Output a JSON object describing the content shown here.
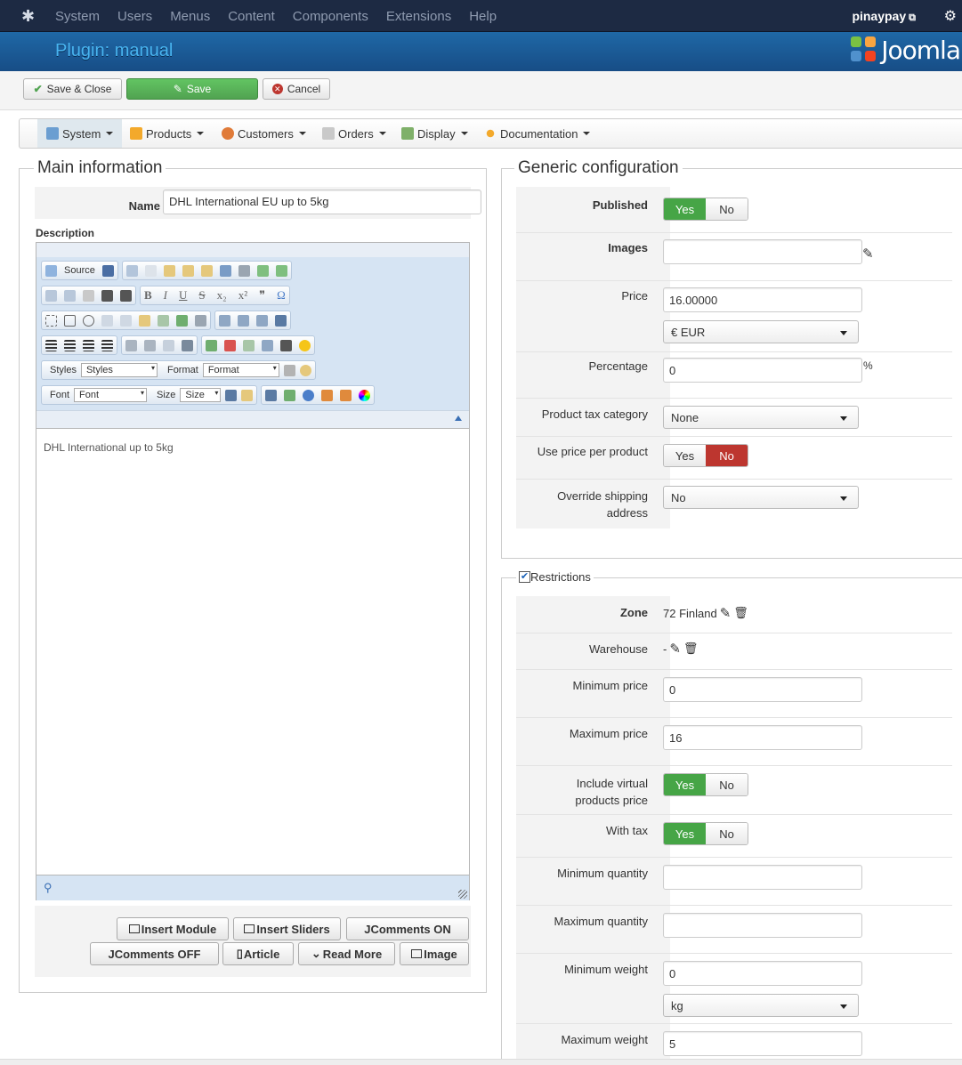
{
  "topbar": {
    "menu": [
      "System",
      "Users",
      "Menus",
      "Content",
      "Components",
      "Extensions",
      "Help"
    ],
    "user": "pinaypay"
  },
  "header": {
    "title": "Plugin: manual",
    "brand": "Joomla"
  },
  "toolbar": {
    "save_close": "Save & Close",
    "save": "Save",
    "cancel": "Cancel"
  },
  "subnav": {
    "items": [
      "System",
      "Products",
      "Customers",
      "Orders",
      "Display",
      "Documentation"
    ]
  },
  "main_info": {
    "legend": "Main information",
    "name_label": "Name",
    "name_value": "DHL International EU up to 5kg",
    "description_label": "Description",
    "editor_toolbar": {
      "source": "Source",
      "styles_label": "Styles",
      "styles_value": "Styles",
      "format_label": "Format",
      "format_value": "Format",
      "font_label": "Font",
      "font_value": "Font",
      "size_label": "Size",
      "size_value": "Size"
    },
    "editor_content": "DHL International up to 5kg",
    "buttons": [
      "Insert Module",
      "Insert Sliders",
      "JComments ON",
      "JComments OFF",
      "Article",
      "Read More",
      "Image"
    ]
  },
  "generic": {
    "legend": "Generic configuration",
    "published_label": "Published",
    "yes": "Yes",
    "no": "No",
    "images_label": "Images",
    "price_label": "Price",
    "price_value": "16.00000",
    "currency_value": "€ EUR",
    "percentage_label": "Percentage",
    "percentage_value": "0",
    "percent_sign": "%",
    "tax_label": "Product tax category",
    "tax_value": "None",
    "price_per_product_label": "Use price per product",
    "override_label_1": "Override shipping",
    "override_label_2": "address",
    "override_value": "No"
  },
  "restrictions": {
    "legend": "Restrictions",
    "zone_label": "Zone",
    "zone_value": "72 Finland",
    "warehouse_label": "Warehouse",
    "warehouse_value": "-",
    "min_price_label": "Minimum price",
    "min_price_value": "0",
    "max_price_label": "Maximum price",
    "max_price_value": "16",
    "virtual_label_1": "Include virtual",
    "virtual_label_2": "products price",
    "with_tax_label": "With tax",
    "min_qty_label": "Minimum quantity",
    "max_qty_label": "Maximum quantity",
    "min_weight_label": "Minimum weight",
    "min_weight_value": "0",
    "weight_unit": "kg",
    "max_weight_label": "Maximum weight",
    "max_weight_value": "5"
  },
  "colors": {
    "header_blue": "#1f68a6",
    "green": "#46a546",
    "red": "#bd362f",
    "topbar": "#1d2a43"
  }
}
